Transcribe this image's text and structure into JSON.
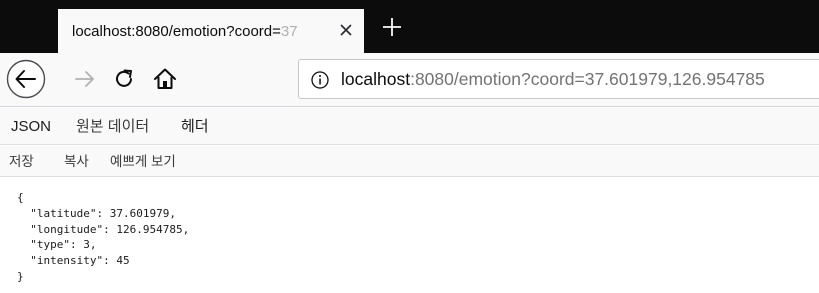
{
  "tab": {
    "title": "localhost:8080/emotion?coord=",
    "title_faded": "37"
  },
  "urlbar": {
    "host": "localhost",
    "rest": ":8080/emotion?coord=37.601979,126.954785"
  },
  "icons": {
    "close": "close-icon",
    "new_tab": "plus-icon",
    "back": "back-arrow-icon",
    "forward": "forward-arrow-icon",
    "reload": "reload-icon",
    "home": "home-icon",
    "info": "info-icon"
  },
  "viewer_tabs": {
    "json": "JSON",
    "raw": "원본 데이터",
    "headers": "헤더"
  },
  "toolbar": {
    "save": "저장",
    "copy": "복사",
    "pretty_print": "예쁘게 보기"
  },
  "raw_json": "{\n  \"latitude\": 37.601979,\n  \"longitude\": 126.954785,\n  \"type\": 3,\n  \"intensity\": 45\n}",
  "colors": {
    "tabstrip_bg": "#0c0c0d",
    "toolbar_bg": "#f9f9fa",
    "accent": "#0a84ff"
  }
}
